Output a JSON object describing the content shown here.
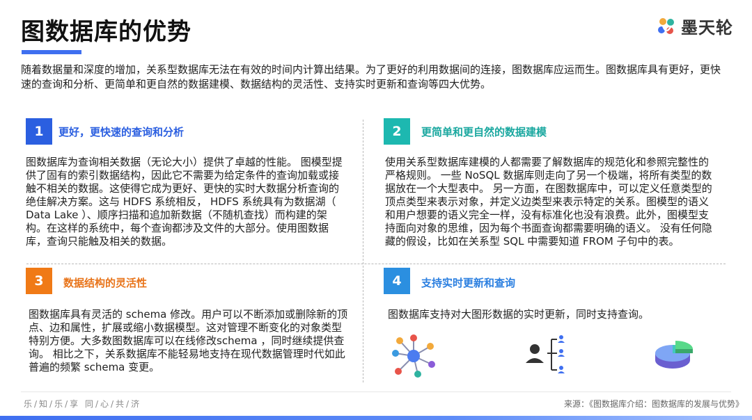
{
  "header": {
    "title": "图数据库的优势",
    "logo_text": "墨天轮",
    "colors": {
      "accent": "#3f6ff0"
    }
  },
  "intro": "随着数据量和深度的增加，关系型数据库无法在有效的时间内计算出结果。为了更好的利用数据间的连接，图数据库应运而生。图数据库具有更好，更快速的查询和分析、更简单和更自然的数据建模、数据结构的灵活性、支持实时更新和查询等四大优势。",
  "sections": [
    {
      "number": "1",
      "title": "更好，更快速的查询和分析",
      "color": "#2b5fe0",
      "body": "图数据库为查询相关数据（无论大小）提供了卓越的性能。 图模型提供了固有的索引数据结构，因此它不需要为给定条件的查询加载或接触不相关的数据。这使得它成为更好、更快的实时大数据分析查询的绝佳解决方案。这与 HDFS 系统相反， HDFS 系统具有为数据湖（ Data Lake ）、顺序扫描和追加新数据（不随机查找）而构建的架构。在这样的系统中，每个查询都涉及文件的大部分。使用图数据库，查询只能触及相关的数据。"
    },
    {
      "number": "2",
      "title": "更简单和更自然的数据建模",
      "color": "#1db8b0",
      "body": "使用关系型数据库建模的人都需要了解数据库的规范化和参照完整性的严格规则。 一些 NoSQL 数据库则走向了另一个极端，将所有类型的数据放在一个大型表中。 另一方面，在图数据库中，可以定义任意类型的顶点类型来表示对象，并定义边类型来表示特定的关系。图模型的语义和用户想要的语义完全一样，没有标准化也没有浪费。此外，图模型支持面向对象的思维，因为每个书面查询都需要明确的语义。 没有任何隐藏的假设，比如在关系型 SQL 中需要知道 FROM 子句中的表。"
    },
    {
      "number": "3",
      "title": "数据结构的灵活性",
      "color": "#f07a16",
      "body": "图数据库具有灵活的 schema 修改。用户可以不断添加或删除新的顶点、边和属性，扩展或缩小数据模型。这对管理不断变化的对象类型特别方便。大多数图数据库可以在线修改schema ，同时继续提供查询。 相比之下，关系数据库不能轻易地支持在现代数据管理时代如此普遍的频繁 schema 变更。"
    },
    {
      "number": "4",
      "title": "支持实时更新和查询",
      "color": "#2b8fe0",
      "body": "图数据库支持对大图形数据的实时更新，同时支持查询。"
    }
  ],
  "icons": [
    "network-graph-icon",
    "user-hierarchy-icon",
    "pie-chart-3d-icon"
  ],
  "footer": {
    "left": "乐/知/乐/享 同/心/共/济",
    "source": "来源：《图数据库介绍：图数据库的发展与优势》"
  }
}
